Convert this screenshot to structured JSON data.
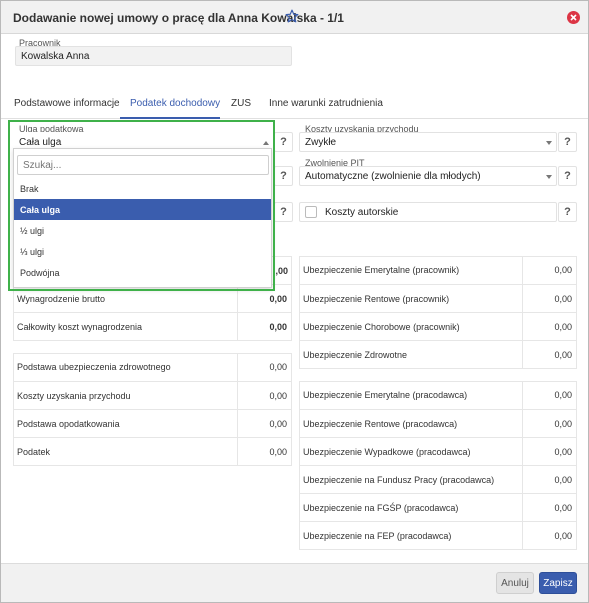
{
  "dialog": {
    "title": "Dodawanie nowej umowy o pracę dla Anna Kowalska - 1/1",
    "icons": {
      "favorite": "star-outline-icon",
      "close": "close-circle-icon"
    },
    "colors": {
      "accent": "#3a5dae",
      "close": "#dc3545",
      "highlight": "#3fb14a"
    }
  },
  "employee": {
    "label": "Pracownik",
    "value": "Kowalska Anna"
  },
  "tabs": [
    {
      "label": "Podstawowe informacje"
    },
    {
      "label": "Podatek dochodowy"
    },
    {
      "label": "ZUS"
    },
    {
      "label": "Inne warunki zatrudnienia"
    }
  ],
  "form": {
    "ulga": {
      "label": "Ulga podatkowa",
      "value": "Cała ulga"
    },
    "koszty": {
      "label": "Koszty uzyskania przychodu",
      "value": "Zwykłe"
    },
    "zwolnienie": {
      "label": "Zwolnienie PIT",
      "value": "Automatyczne (zwolnienie dla młodych)"
    },
    "autorskie": {
      "label": "Koszty autorskie"
    },
    "help": "?"
  },
  "dropdown": {
    "search_placeholder": "Szukaj...",
    "options": [
      "Brak",
      "Cała ulga",
      "½ ulgi",
      "⅓ ulgi",
      "Podwójna"
    ],
    "selected": "Cała ulga"
  },
  "left_top": {
    "partial_value": ",00",
    "rows": [
      {
        "label": "Wynagrodzenie brutto",
        "value": "0,00"
      },
      {
        "label": "Całkowity koszt wynagrodzenia",
        "value": "0,00"
      }
    ]
  },
  "left_bottom": {
    "rows": [
      {
        "label": "Podstawa ubezpieczenia zdrowotnego",
        "value": "0,00"
      },
      {
        "label": "Koszty uzyskania przychodu",
        "value": "0,00"
      },
      {
        "label": "Podstawa opodatkowania",
        "value": "0,00"
      },
      {
        "label": "Podatek",
        "value": "0,00"
      }
    ]
  },
  "right_top": {
    "rows": [
      {
        "label": "Ubezpieczenie Emerytalne (pracownik)",
        "value": "0,00"
      },
      {
        "label": "Ubezpieczenie Rentowe (pracownik)",
        "value": "0,00"
      },
      {
        "label": "Ubezpieczenie Chorobowe (pracownik)",
        "value": "0,00"
      },
      {
        "label": "Ubezpieczenie Zdrowotne",
        "value": "0,00"
      }
    ]
  },
  "right_bottom": {
    "rows": [
      {
        "label": "Ubezpieczenie Emerytalne (pracodawca)",
        "value": "0,00"
      },
      {
        "label": "Ubezpieczenie Rentowe (pracodawca)",
        "value": "0,00"
      },
      {
        "label": "Ubezpieczenie Wypadkowe (pracodawca)",
        "value": "0,00"
      },
      {
        "label": "Ubezpieczenie na Fundusz Pracy (pracodawca)",
        "value": "0,00"
      },
      {
        "label": "Ubezpieczenie na FGŚP (pracodawca)",
        "value": "0,00"
      },
      {
        "label": "Ubezpieczenie na FEP (pracodawca)",
        "value": "0,00"
      }
    ]
  },
  "footer": {
    "cancel_label": "Anuluj",
    "save_label": "Zapisz"
  }
}
